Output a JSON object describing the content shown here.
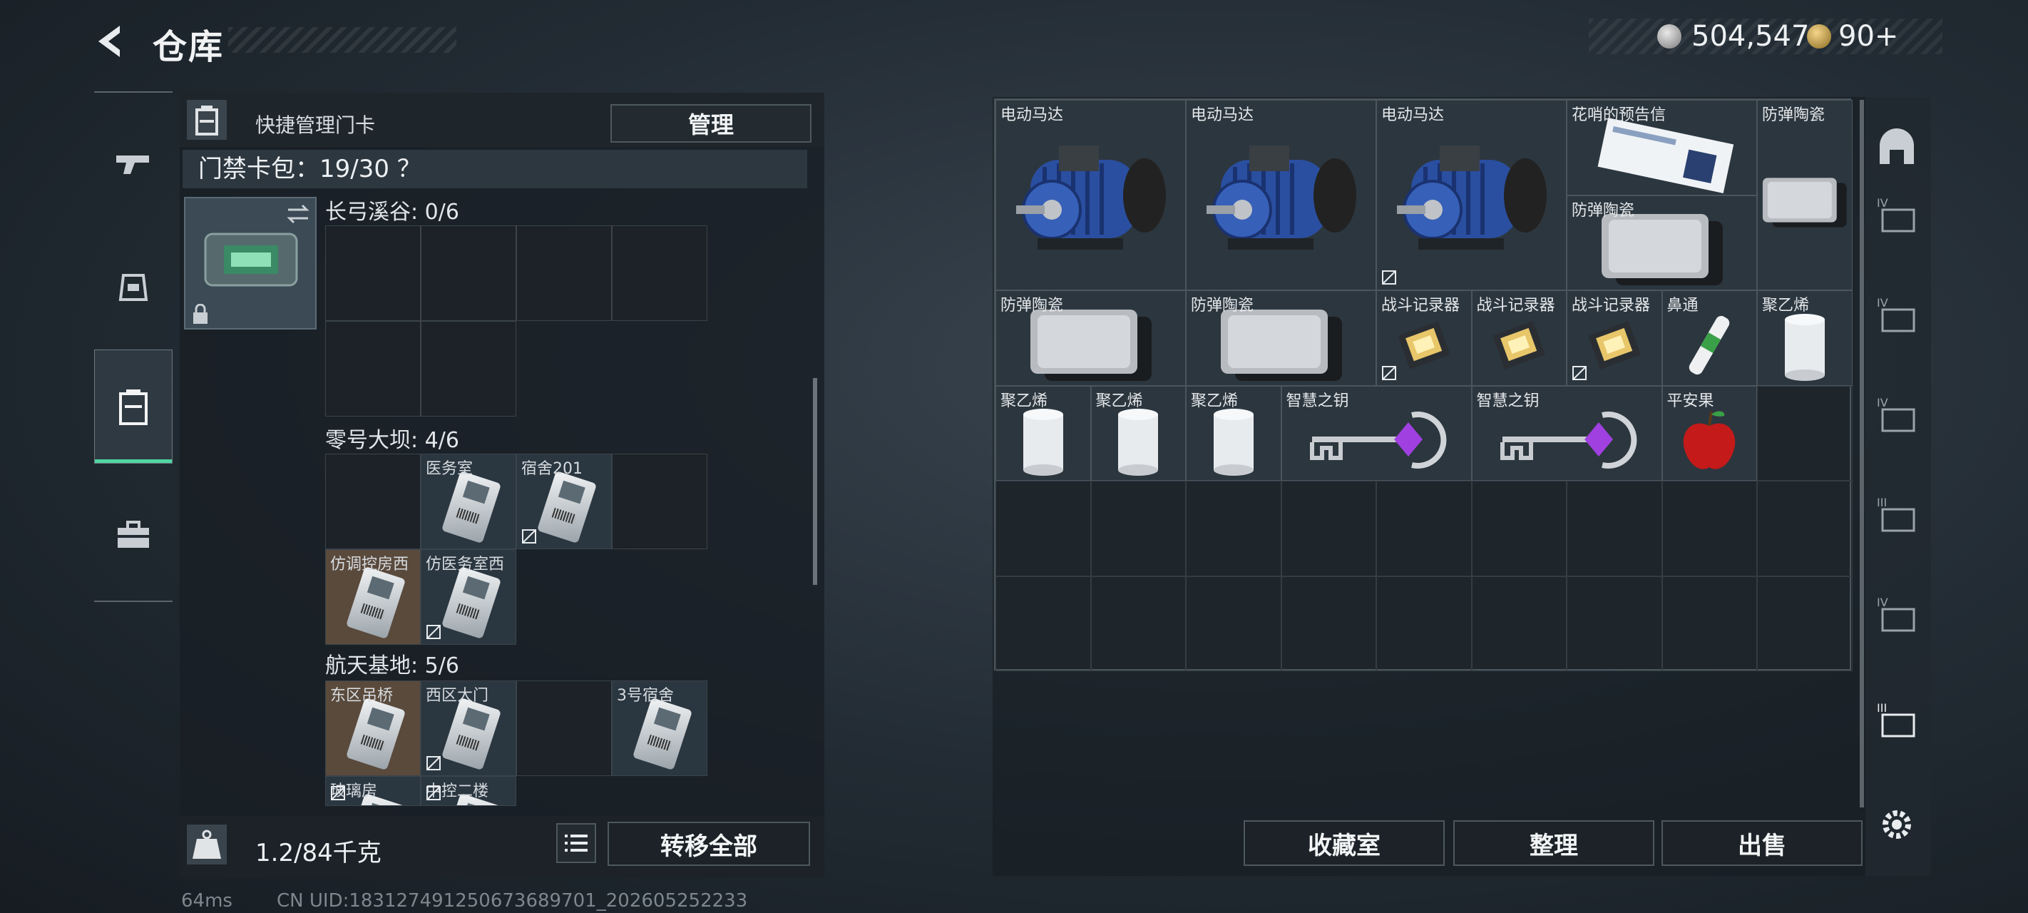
{
  "header": {
    "title": "仓库",
    "currency_1": "504,547",
    "currency_2": "90+"
  },
  "nav": {
    "items": [
      "weapon",
      "armor",
      "keycard",
      "toolbox"
    ],
    "active": 2
  },
  "left_panel": {
    "quick_manage_label": "快捷管理门卡",
    "manage_button": "管理",
    "card_pack": "门禁卡包：19/30 ？",
    "sections": [
      {
        "title": "长弓溪谷: 0/6",
        "slots": [
          "",
          "",
          "",
          "",
          "",
          ""
        ]
      },
      {
        "title": "零号大坝: 4/6",
        "slots": [
          "",
          "医务室",
          "宿舍201",
          "",
          "仿调控房西",
          "仿医务室西"
        ]
      },
      {
        "title": "航天基地: 5/6",
        "slots": [
          "东区吊桥",
          "西区大门",
          "",
          "3号宿舍",
          "玻璃房",
          "中控二楼"
        ]
      }
    ],
    "weight_value": "1.2/84千克",
    "transfer_button": "转移全部"
  },
  "right_panel": {
    "items": [
      {
        "label": "电动马达",
        "kind": "motor"
      },
      {
        "label": "电动马达",
        "kind": "motor"
      },
      {
        "label": "电动马达",
        "kind": "motor"
      },
      {
        "label": "花哨的预告信",
        "kind": "letter"
      },
      {
        "label": "防弹陶瓷",
        "kind": "ceramic"
      },
      {
        "label": "防弹陶瓷",
        "kind": "ceramic"
      },
      {
        "label": "防弹陶瓷",
        "kind": "ceramic"
      },
      {
        "label": "防弹陶瓷",
        "kind": "ceramic"
      },
      {
        "label": "战斗记录器",
        "kind": "recorder"
      },
      {
        "label": "战斗记录器",
        "kind": "recorder"
      },
      {
        "label": "战斗记录器",
        "kind": "recorder"
      },
      {
        "label": "鼻通",
        "kind": "inhaler"
      },
      {
        "label": "聚乙烯",
        "kind": "roll"
      },
      {
        "label": "聚乙烯",
        "kind": "roll"
      },
      {
        "label": "聚乙烯",
        "kind": "roll"
      },
      {
        "label": "聚乙烯",
        "kind": "roll"
      },
      {
        "label": "智慧之钥",
        "kind": "key"
      },
      {
        "label": "智慧之钥",
        "kind": "key"
      },
      {
        "label": "平安果",
        "kind": "apple"
      }
    ],
    "buttons": [
      "收藏室",
      "整理",
      "出售"
    ]
  },
  "status_bar": {
    "ping": "64ms",
    "uid": "CN UID:18312749125067368970​1_202605252233"
  },
  "colors": {
    "accent": "#4fd6a2",
    "motor": "#2a4fa0",
    "apple": "#c41a1a",
    "gem": "#a040e0"
  }
}
